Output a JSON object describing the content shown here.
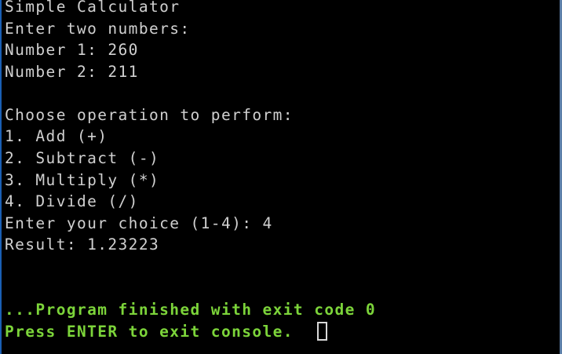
{
  "console": {
    "title_line": "Simple Calculator",
    "prompt_line": "Enter two numbers:",
    "number1_line": "Number 1: 260",
    "number2_line": "Number 2: 211",
    "operation_header": "Choose operation to perform:",
    "options": [
      "1. Add (+)",
      "2. Subtract (-)",
      "3. Multiply (*)",
      "4. Divide (/)"
    ],
    "choice_line": "Enter your choice (1-4): 4",
    "result_line": "Result: 1.23223",
    "exit_message": "...Program finished with exit code 0",
    "press_enter_message": "Press ENTER to exit console."
  },
  "colors": {
    "background": "#000000",
    "text": "#d0d0d0",
    "status_green": "#7cd43a"
  },
  "icons": {
    "cursor": "block-cursor-icon"
  }
}
